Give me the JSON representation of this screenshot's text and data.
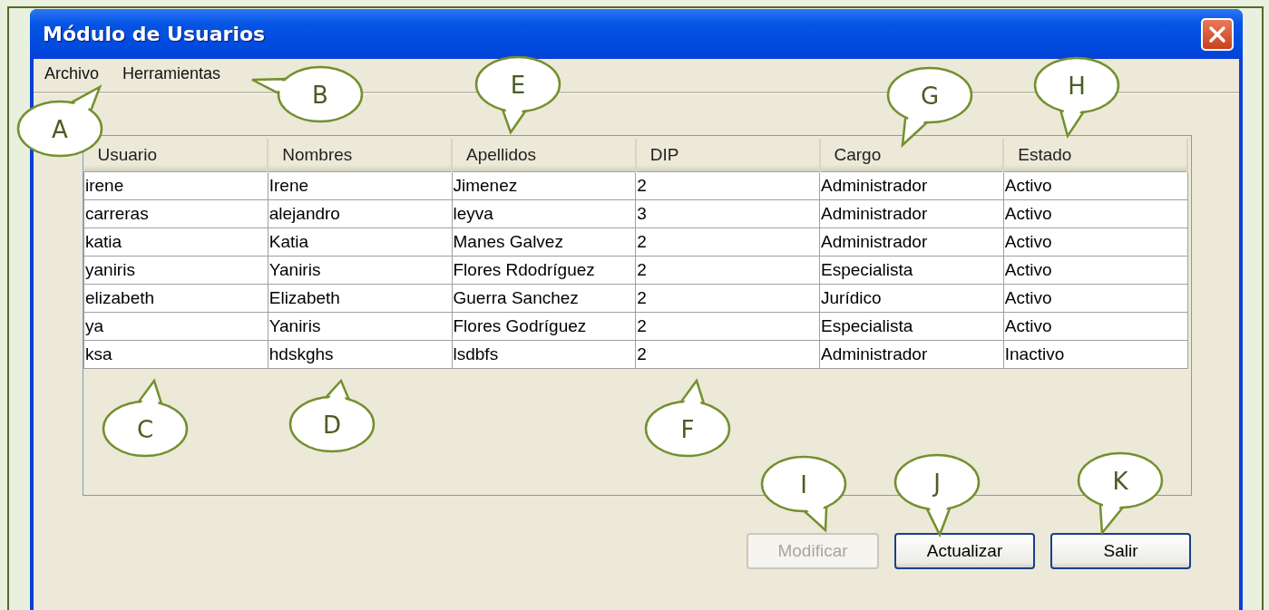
{
  "window": {
    "title": "Módulo de Usuarios"
  },
  "menu": [
    "Archivo",
    "Herramientas"
  ],
  "table": {
    "columns": [
      "Usuario",
      "Nombres",
      "Apellidos",
      "DIP",
      "Cargo",
      "Estado"
    ],
    "rows": [
      [
        "irene",
        "Irene",
        "Jimenez",
        "2",
        "Administrador",
        "Activo"
      ],
      [
        "carreras",
        "alejandro",
        "leyva",
        "3",
        "Administrador",
        "Activo"
      ],
      [
        "katia",
        "Katia",
        "Manes Galvez",
        "2",
        "Administrador",
        "Activo"
      ],
      [
        "yaniris",
        "Yaniris",
        "Flores Rdodríguez",
        "2",
        "Especialista",
        "Activo"
      ],
      [
        "elizabeth",
        "Elizabeth",
        "Guerra Sanchez",
        "2",
        "Jurídico",
        "Activo"
      ],
      [
        "ya",
        "Yaniris",
        "Flores Godríguez",
        "2",
        "Especialista",
        "Activo"
      ],
      [
        "ksa",
        "hdskghs",
        "lsdbfs",
        "2",
        "Administrador",
        "Inactivo"
      ]
    ]
  },
  "buttons": [
    {
      "label": "Modificar",
      "disabled": true
    },
    {
      "label": "Actualizar",
      "disabled": false
    },
    {
      "label": "Salir",
      "disabled": false
    }
  ],
  "callouts": [
    "A",
    "B",
    "C",
    "D",
    "E",
    "F",
    "G",
    "H",
    "I",
    "J",
    "K"
  ]
}
